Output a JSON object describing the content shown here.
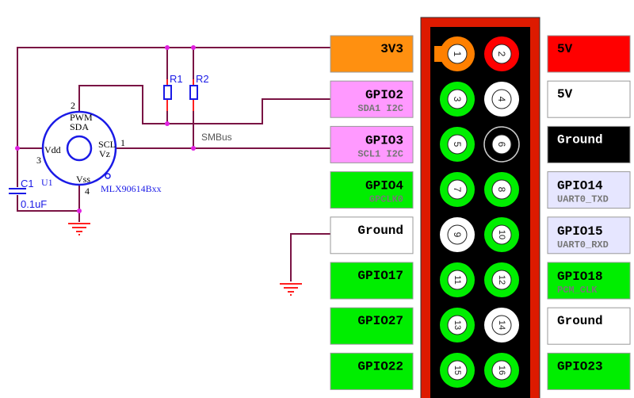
{
  "schematic": {
    "u1": {
      "ref": "U1",
      "part": "MLX90614Bxx",
      "pin_pwm": "PWM",
      "pin_sda": "SDA",
      "pin_scl": "SCL",
      "pin_vz": "Vz",
      "pin_vdd": "Vdd",
      "pin_vss": "Vss",
      "pin1": "1",
      "pin2": "2",
      "pin3": "3",
      "pin4": "4"
    },
    "r1": "R1",
    "r2": "R2",
    "c1": {
      "ref": "C1",
      "value": "0.1uF"
    },
    "bus_label": "SMBus"
  },
  "colors": {
    "wire": "#7a1444",
    "junction": "#e020e0",
    "component": "#1a1ae6",
    "ground": "#ff2020",
    "header_frame": "#dd1a00"
  },
  "left_pins": [
    {
      "label": "3V3",
      "sub": "",
      "bg": "#ff9010",
      "fg": "#000"
    },
    {
      "label": "GPIO2",
      "sub": "SDA1 I2C",
      "bg": "#ff99ff",
      "fg": "#000"
    },
    {
      "label": "GPIO3",
      "sub": "SCL1 I2C",
      "bg": "#ff99ff",
      "fg": "#000"
    },
    {
      "label": "GPIO4",
      "sub": "GPCLK0",
      "bg": "#00ee00",
      "fg": "#000"
    },
    {
      "label": "Ground",
      "sub": "",
      "bg": "#ffffff",
      "fg": "#000"
    },
    {
      "label": "GPIO17",
      "sub": "",
      "bg": "#00ee00",
      "fg": "#000"
    },
    {
      "label": "GPIO27",
      "sub": "",
      "bg": "#00ee00",
      "fg": "#000"
    },
    {
      "label": "GPIO22",
      "sub": "",
      "bg": "#00ee00",
      "fg": "#000"
    }
  ],
  "right_pins": [
    {
      "label": "5V",
      "sub": "",
      "bg": "#ff0000",
      "fg": "#000"
    },
    {
      "label": "5V",
      "sub": "",
      "bg": "#ffffff",
      "fg": "#000"
    },
    {
      "label": "Ground",
      "sub": "",
      "bg": "#000000",
      "fg": "#fff"
    },
    {
      "label": "GPIO14",
      "sub": "UART0_TXD",
      "bg": "#e6e6ff",
      "fg": "#000"
    },
    {
      "label": "GPIO15",
      "sub": "UART0_RXD",
      "bg": "#e6e6ff",
      "fg": "#000"
    },
    {
      "label": "GPIO18",
      "sub": "PCM_CLK",
      "bg": "#00ee00",
      "fg": "#000"
    },
    {
      "label": "Ground",
      "sub": "",
      "bg": "#ffffff",
      "fg": "#000"
    },
    {
      "label": "GPIO23",
      "sub": "",
      "bg": "#00ee00",
      "fg": "#000"
    }
  ],
  "header_pins": [
    {
      "num": "1",
      "color": "#ff8000"
    },
    {
      "num": "2",
      "color": "#ff0000"
    },
    {
      "num": "3",
      "color": "#00ee00"
    },
    {
      "num": "4",
      "color": "#ffffff"
    },
    {
      "num": "5",
      "color": "#00ee00"
    },
    {
      "num": "6",
      "color": "#000000"
    },
    {
      "num": "7",
      "color": "#00ee00"
    },
    {
      "num": "8",
      "color": "#00ee00"
    },
    {
      "num": "9",
      "color": "#ffffff"
    },
    {
      "num": "10",
      "color": "#00ee00"
    },
    {
      "num": "11",
      "color": "#00ee00"
    },
    {
      "num": "12",
      "color": "#00ee00"
    },
    {
      "num": "13",
      "color": "#00ee00"
    },
    {
      "num": "14",
      "color": "#ffffff"
    },
    {
      "num": "15",
      "color": "#00ee00"
    },
    {
      "num": "16",
      "color": "#00ee00"
    }
  ]
}
